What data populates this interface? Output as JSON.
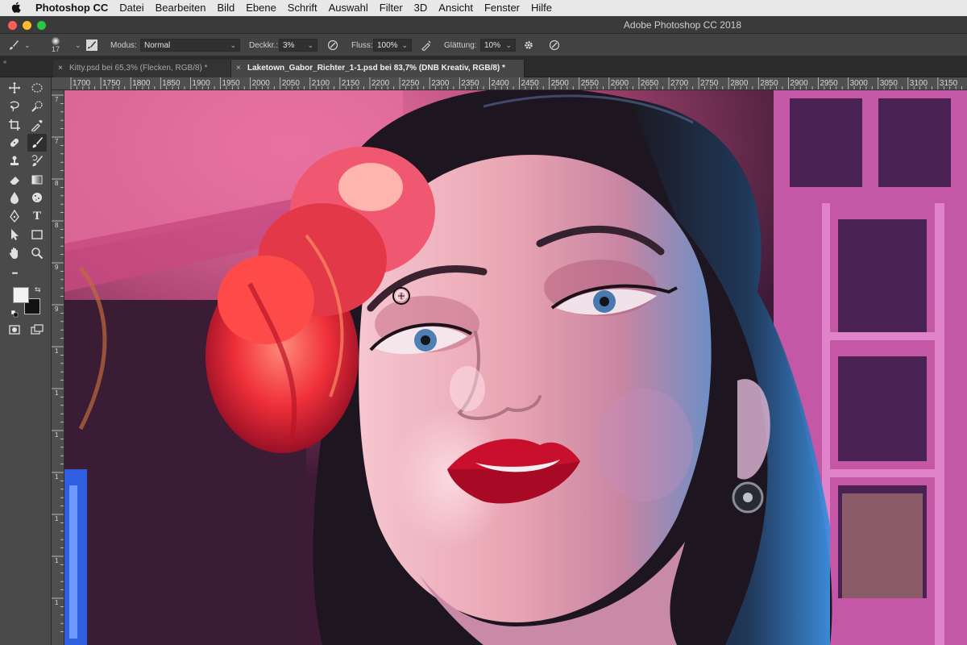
{
  "menubar": {
    "app_name": "Photoshop CC",
    "items": [
      "Datei",
      "Bearbeiten",
      "Bild",
      "Ebene",
      "Schrift",
      "Auswahl",
      "Filter",
      "3D",
      "Ansicht",
      "Fenster",
      "Hilfe"
    ]
  },
  "window": {
    "title": "Adobe Photoshop CC 2018"
  },
  "options": {
    "brush_size": "17",
    "mode_label": "Modus:",
    "mode_value": "Normal",
    "opacity_label": "Deckkr.:",
    "opacity_value": "3%",
    "flow_label": "Fluss:",
    "flow_value": "100%",
    "smoothing_label": "Glättung:",
    "smoothing_value": "10%"
  },
  "tabs": [
    {
      "label": "Kitty.psd bei 65,3% (Flecken, RGB/8) *",
      "close": "×",
      "active": false
    },
    {
      "label": "Laketown_Gabor_Richter_1-1.psd bei 83,7% (DNB Kreativ, RGB/8) *",
      "close": "×",
      "active": true
    }
  ],
  "ruler_top": [
    "1700",
    "1750",
    "1800",
    "1850",
    "1900",
    "1950",
    "2000",
    "2050",
    "2100",
    "2150",
    "2200",
    "2250",
    "2300",
    "2350",
    "2400",
    "2450",
    "2500",
    "2550",
    "2600",
    "2650",
    "2700",
    "2750",
    "2800",
    "2850",
    "2900",
    "2950",
    "3000",
    "3050",
    "3100",
    "3150"
  ],
  "ruler_left": [
    "7",
    "7",
    "8",
    "8",
    "9",
    "9",
    "1",
    "1",
    "1",
    "1",
    "1",
    "1",
    "1"
  ],
  "colors": {
    "foreground": "#f2f2f2",
    "background": "#111111",
    "accent_active_tab": "#464646"
  },
  "toolbar": {
    "more_tools": "•••",
    "text_tool": "T"
  }
}
